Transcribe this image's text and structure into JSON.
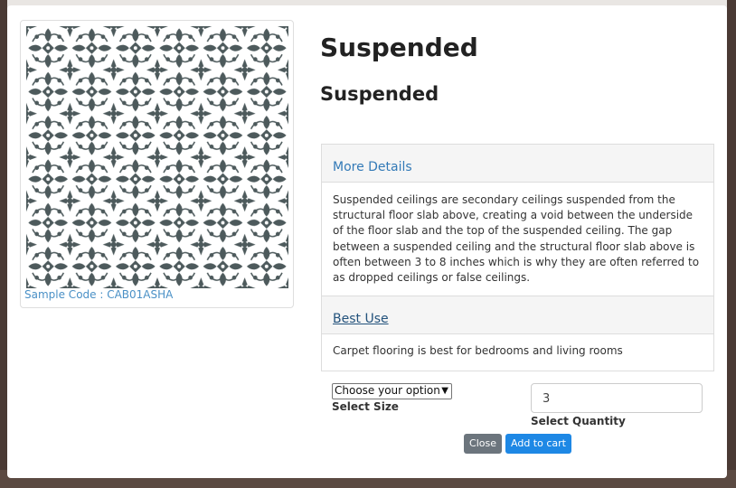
{
  "modal": {
    "title": "Suspended",
    "subtitle": "Suspended",
    "sample_code": "Sample Code : CAB01ASHA",
    "more_details": {
      "heading": "More Details",
      "body": "Suspended ceilings are secondary ceilings suspended from the structural floor slab above, creating a void between the underside of the floor slab and the top of the suspended ceiling. The gap between a suspended ceiling and the structural floor slab above is often between 3 to 8 inches which is why they are often referred to as dropped ceilings or false ceilings."
    },
    "best_use": {
      "heading": "Best Use",
      "body": "Carpet flooring is best for bedrooms and living rooms"
    },
    "size": {
      "selected": "Choose your option",
      "label": "Select Size"
    },
    "quantity": {
      "value": "3",
      "label": "Select Quantity"
    },
    "buttons": {
      "close": "Close",
      "add_to_cart": "Add to cart"
    }
  },
  "colors": {
    "pattern": "#4d5a5c",
    "link": "#337ab7",
    "add_button": "#1e88e5",
    "close_button": "#6c757d"
  }
}
